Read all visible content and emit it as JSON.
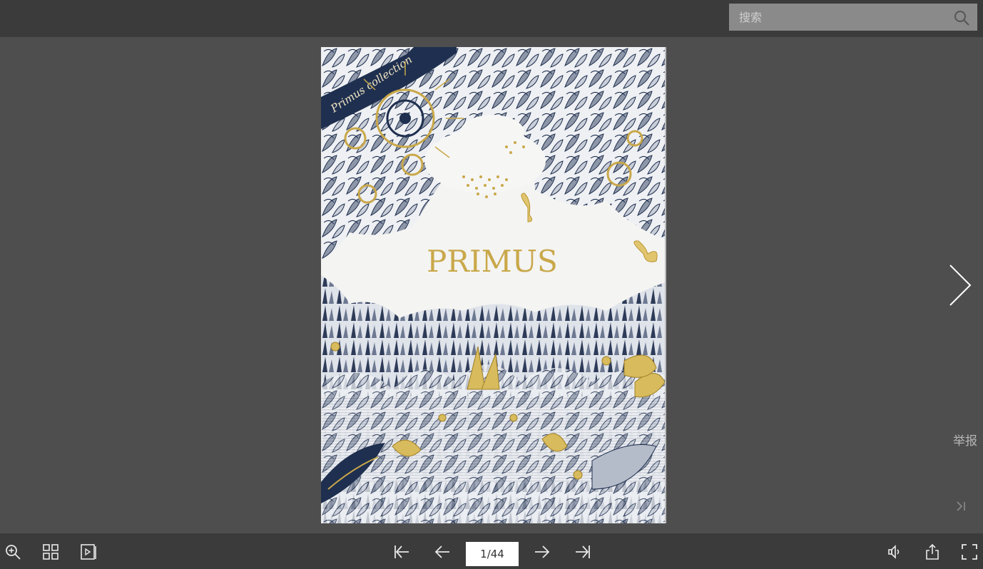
{
  "search": {
    "placeholder": "搜索"
  },
  "page": {
    "banner_text": "Primus collection",
    "title": "PRIMUS"
  },
  "side": {
    "report_label": "举报"
  },
  "pager": {
    "current": "1/44"
  },
  "icons": {
    "search": "search-icon",
    "zoom": "zoom-in-icon",
    "thumbnails": "grid-icon",
    "autoplay": "play-icon",
    "first": "first-page-icon",
    "prev": "arrow-left-icon",
    "next": "arrow-right-icon",
    "last": "last-page-icon",
    "sound": "sound-icon",
    "share": "share-icon",
    "fullscreen": "fullscreen-icon"
  },
  "colors": {
    "gold": "#c9a84a",
    "navy": "#1f2f4f"
  }
}
